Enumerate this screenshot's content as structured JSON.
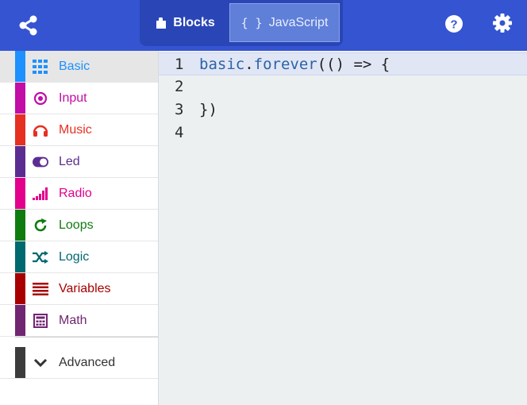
{
  "header": {
    "blocks_label": "Blocks",
    "js_label": "JavaScript",
    "js_icon_text": "{ }"
  },
  "sidebar": {
    "categories": [
      {
        "label": "Basic",
        "color": "#1e90ff",
        "icon": "grid-icon",
        "selected": true
      },
      {
        "label": "Input",
        "color": "#c20da6",
        "icon": "target-icon"
      },
      {
        "label": "Music",
        "color": "#e63022",
        "icon": "headphones-icon"
      },
      {
        "label": "Led",
        "color": "#5c2d91",
        "icon": "toggle-icon"
      },
      {
        "label": "Radio",
        "color": "#e3008c",
        "icon": "signal-icon"
      },
      {
        "label": "Loops",
        "color": "#107c10",
        "icon": "loop-icon"
      },
      {
        "label": "Logic",
        "color": "#006970",
        "icon": "shuffle-icon"
      },
      {
        "label": "Variables",
        "color": "#a80000",
        "icon": "list-icon"
      },
      {
        "label": "Math",
        "color": "#712672",
        "icon": "calculator-icon"
      }
    ],
    "advanced": {
      "label": "Advanced",
      "color": "#3c3c3c",
      "icon": "chevron-down-icon"
    }
  },
  "editor": {
    "lines": [
      {
        "number": "1",
        "obj": "basic",
        "dot": ".",
        "fn": "forever",
        "rest": "(() => {"
      },
      {
        "number": "2",
        "text": ""
      },
      {
        "number": "3",
        "text": "})"
      },
      {
        "number": "4",
        "text": ""
      }
    ]
  }
}
